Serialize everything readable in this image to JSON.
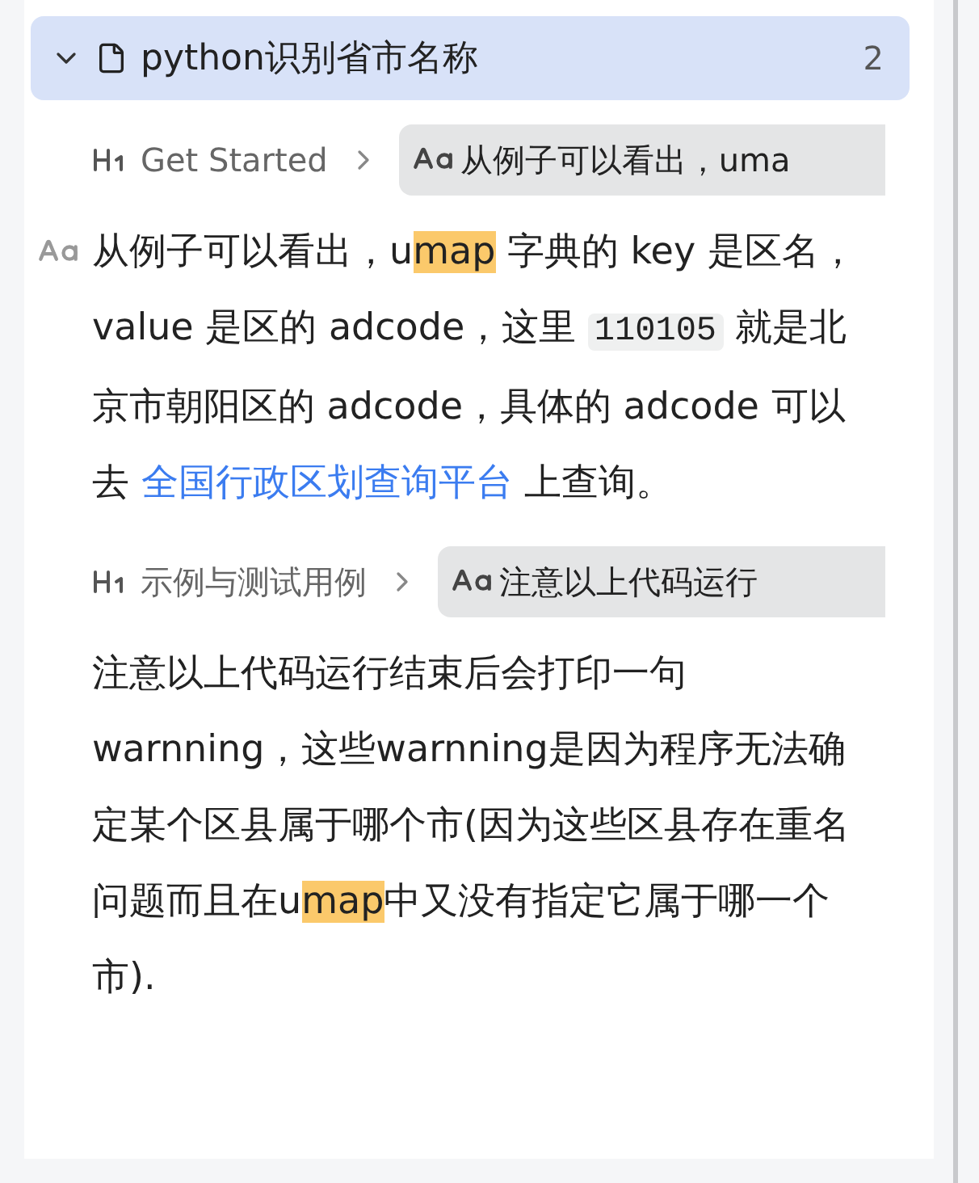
{
  "document": {
    "title": "python识别省市名称",
    "count": "2",
    "expanded": true,
    "selected": true
  },
  "results": [
    {
      "breadcrumb": {
        "heading": "Get Started",
        "snippet": "从例子可以看出，uma"
      },
      "show_type_icon": true,
      "segments": [
        {
          "kind": "text",
          "text": "从例子可以看出，u"
        },
        {
          "kind": "mark",
          "text": "map"
        },
        {
          "kind": "text",
          "text": " 字典的 key 是区名，value 是区的 adcode，这里 "
        },
        {
          "kind": "code",
          "text": "110105"
        },
        {
          "kind": "text",
          "text": " 就是北京市朝阳区的 adcode，具体的 adcode 可以去 "
        },
        {
          "kind": "link",
          "text": "全国行政区划查询平台"
        },
        {
          "kind": "text",
          "text": " 上查询。"
        }
      ]
    },
    {
      "breadcrumb": {
        "heading": "示例与测试用例",
        "snippet": "注意以上代码运行"
      },
      "show_type_icon": false,
      "segments": [
        {
          "kind": "text",
          "text": "注意以上代码运行结束后会打印一句warnning，这些warnning是因为程序无法确定某个区县属于哪个市(因为这些区县存在重名问题而且在u"
        },
        {
          "kind": "mark",
          "text": "map"
        },
        {
          "kind": "text",
          "text": "中又没有指定它属于哪一个市)."
        }
      ]
    }
  ]
}
